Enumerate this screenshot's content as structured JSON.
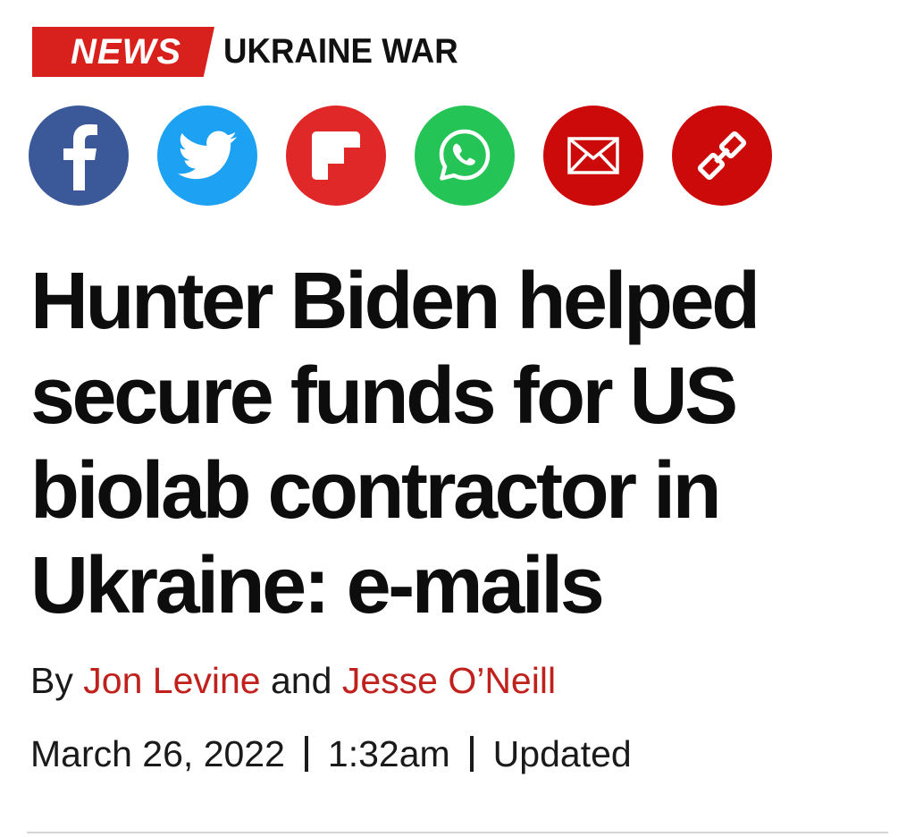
{
  "section": {
    "badge_label": "NEWS",
    "topic_label": "UKRAINE WAR",
    "badge_color": "#d8201d"
  },
  "share": [
    {
      "name": "facebook",
      "icon": "facebook-icon",
      "color": "#3b5998"
    },
    {
      "name": "twitter",
      "icon": "twitter-icon",
      "color": "#1da1f2"
    },
    {
      "name": "flipboard",
      "icon": "flipboard-icon",
      "color": "#e12828"
    },
    {
      "name": "whatsapp",
      "icon": "whatsapp-icon",
      "color": "#25d366"
    },
    {
      "name": "email",
      "icon": "envelope-icon",
      "color": "#cc0000"
    },
    {
      "name": "copy-link",
      "icon": "link-icon",
      "color": "#cc0000"
    }
  ],
  "article": {
    "headline": "Hunter Biden helped secure funds for US biolab contractor in Ukraine: e-mails",
    "byline": {
      "prefix": "By",
      "author1": "Jon Levine",
      "conjunction": "and",
      "author2": "Jesse O’Neill",
      "author_color": "#c0211d"
    },
    "date": "March 26, 2022",
    "time": "1:32am",
    "updated_label": "Updated"
  }
}
